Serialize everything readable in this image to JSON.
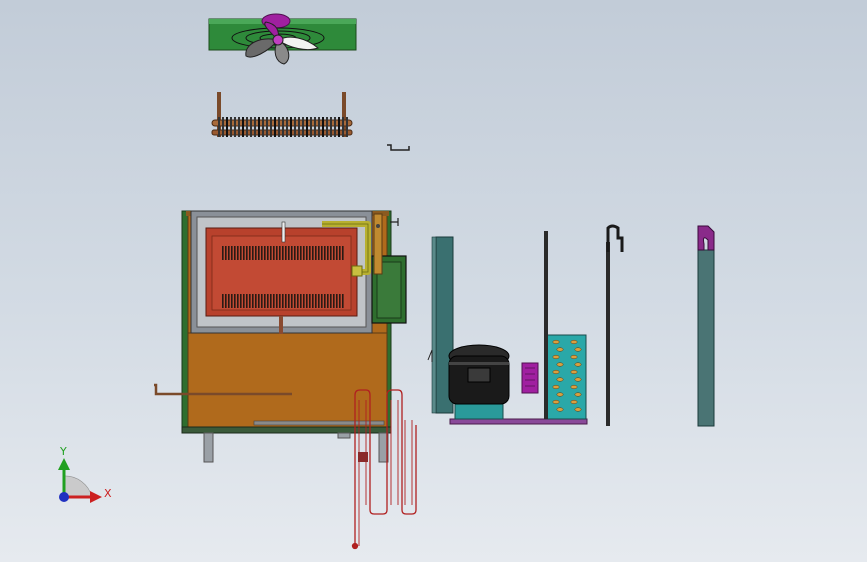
{
  "viewport": {
    "background_top": "#c2ccd8",
    "background_bottom": "#e6eaef"
  },
  "triad": {
    "x_label": "X",
    "y_label": "Y",
    "x_color": "#cc2020",
    "y_color": "#20a020",
    "z_color": "#2030c0"
  },
  "colors": {
    "cabinet_body": "#b06a1c",
    "cabinet_dark": "#5a3a14",
    "frame_green": "#2e6e2e",
    "chamber_red": "#b8412c",
    "chamber_frame": "#9aa0a8",
    "pipe_yellow": "#b8b030",
    "fan_green": "#2e8a3a",
    "fan_magenta": "#a020a0",
    "compressor_black": "#1a1a1a",
    "teal": "#2a9a9a",
    "slate": "#4a7474",
    "purple": "#8a2a8a",
    "copper": "#8a5a3a",
    "red_wire": "#b02020"
  }
}
